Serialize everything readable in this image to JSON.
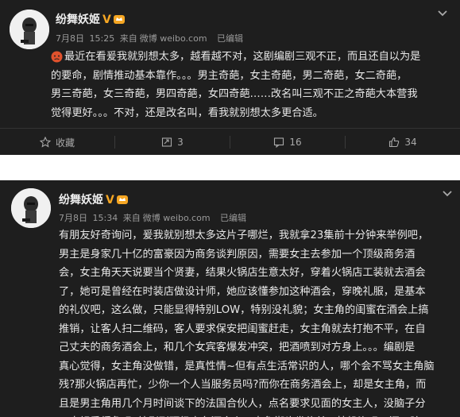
{
  "posts": [
    {
      "username": "纷舞妖姬",
      "badge": "V",
      "date": "7月8日",
      "time": "15:25",
      "source_prefix": "来自",
      "source": "微博 weibo.com",
      "edited": "已编辑",
      "text": "最近在看爰我就别想太多，越看越不对，这剧编剧三观不正，而且还自以为是\n的要命，剧情推动基本靠作。。。男主奇葩，女主奇葩，男二奇葩，女二奇葩，\n男三奇葩，女三奇葩，男四奇葩，女四奇葩……改名叫三观不正之奇葩大本营我\n觉得更好。。。不对，还是改名叫，看我就别想太多更合适。",
      "actions": {
        "favorite": "收藏",
        "repost_count": "3",
        "comment_count": "16",
        "like_count": "34"
      }
    },
    {
      "username": "纷舞妖姬",
      "badge": "V",
      "date": "7月8日",
      "time": "15:34",
      "source_prefix": "来自",
      "source": "微博 weibo.com",
      "edited": "已编辑",
      "text": "有朋友好奇询问，爰我就别想太多这片子哪烂，我就拿23集前十分钟来举例吧，\n男主是身家几十亿的富豪因为商务谈判原因，需要女主去参加一个顶级商务酒\n会，女主角天天说要当个贤妻，结果火锅店生意太好，穿着火锅店工装就去酒会\n了，她可是曾经在时装店做设计师，她应该懂参加这种酒会，穿晚礼服，是基本\n的礼仪吧，这么做，只能显得特别LOW，特别没礼貌；女主角的闺蜜在酒会上搞\n推销，让客人扫二维码，客人要求保安把闺蜜赶走，女主角就去打抱不平，在自\n己丈夫的商务酒会上，和几个女宾客爆发冲突，把酒喷到对方身上。。。编剧是\n真心觉得，女主角没做错，是真性情~但有点生活常识的人，哪个会不骂女主角脑\n残?那火锅店再忙，少你一个人当服务员吗?而你在商务酒会上，却是女主角，而\n且是男主角用几个月时间谈下的法国合伙人，点名要求见面的女主人，没脑子分\n不出轻重缓急吗?编剧到顶级商务酒会上，去象街头发传单，拉投资吗，还一脸"
    }
  ],
  "colors": {
    "card_bg": "#1e1e1e",
    "page_bg": "#ffffff",
    "vip_orange": "#f5a623",
    "meta_gray": "#9a9a9a"
  },
  "icons": [
    "chevron-down-icon",
    "crown-icon",
    "star-icon",
    "repost-icon",
    "comment-icon",
    "like-icon"
  ]
}
